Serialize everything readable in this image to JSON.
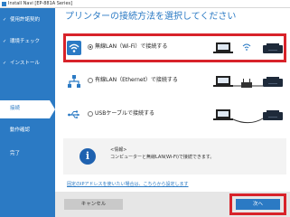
{
  "window": {
    "title": "Install Navi [EP-881A Series]"
  },
  "sidebar": {
    "items": [
      {
        "label": "使用許諾契約",
        "state": "done"
      },
      {
        "label": "環境チェック",
        "state": "done"
      },
      {
        "label": "インストール",
        "state": "done"
      },
      {
        "label": "接続",
        "state": "active"
      },
      {
        "label": "動作確認",
        "state": "pending"
      },
      {
        "label": "完了",
        "state": "pending"
      }
    ],
    "check_mark": "✓"
  },
  "main": {
    "heading": "プリンターの接続方法を選択してください",
    "options": [
      {
        "label": "無線LAN（Wi-Fi）で接続する",
        "icon": "wifi-icon",
        "selected": true
      },
      {
        "label": "有線LAN（Ethernet）で接続する",
        "icon": "lan-icon",
        "selected": false
      },
      {
        "label": "USBケーブルで接続する",
        "icon": "usb-icon",
        "selected": false
      }
    ],
    "info": {
      "icon": "info-icon",
      "title": "<情報>",
      "text": "コンピューターと無線LAN(Wi-Fi)で接続できます。"
    },
    "ip_link": "固定のIPアドレスを使いたい場合は、こちらから設定します"
  },
  "footer": {
    "cancel_label": "キャンセル",
    "next_label": "次へ"
  },
  "colors": {
    "brand_blue": "#2b7ac4",
    "highlight_red": "#d8232a"
  }
}
